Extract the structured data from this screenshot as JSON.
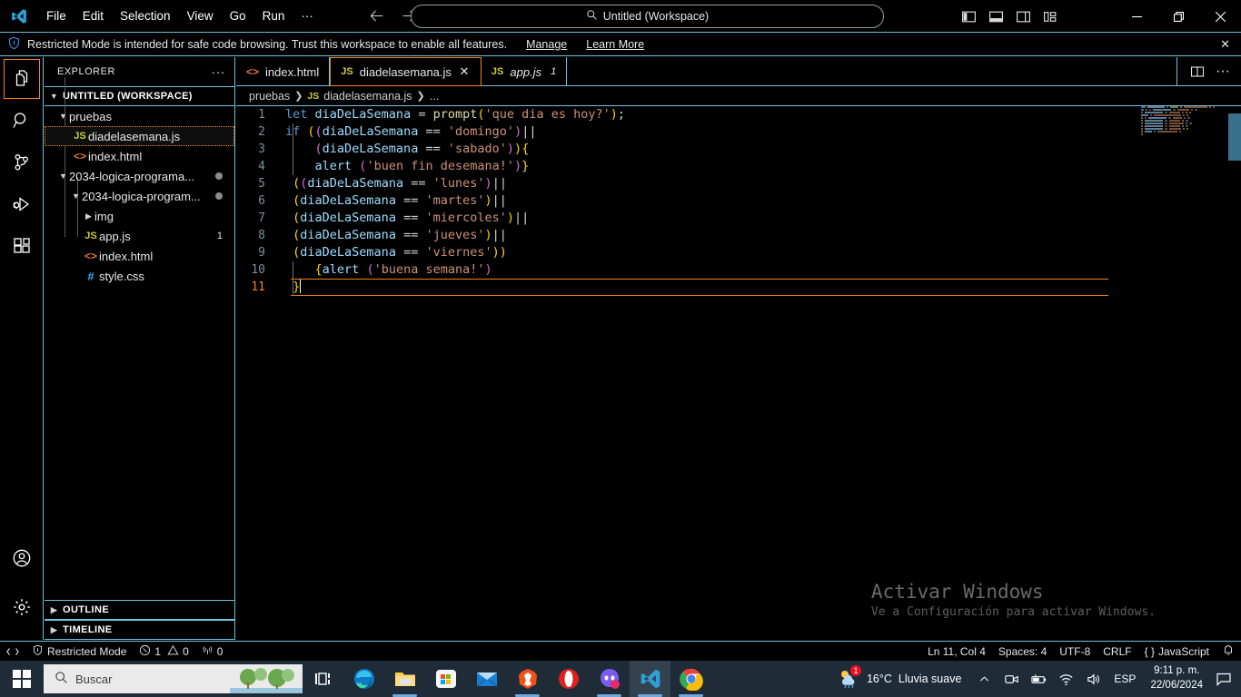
{
  "titlebar": {
    "logo_icon": "vscode-logo",
    "menus": [
      "File",
      "Edit",
      "Selection",
      "View",
      "Go",
      "Run",
      "···"
    ],
    "back_icon": "arrow-left-icon",
    "forward_icon": "arrow-right-icon",
    "command_center": {
      "icon": "search-icon",
      "text": "Untitled (Workspace)"
    },
    "layout_buttons": [
      {
        "name": "toggle-primary-sidebar",
        "icon": "layout-sidebar-left-icon"
      },
      {
        "name": "toggle-panel",
        "icon": "layout-panel-icon"
      },
      {
        "name": "toggle-secondary-sidebar",
        "icon": "layout-sidebar-right-icon"
      },
      {
        "name": "customize-layout",
        "icon": "layout-customize-icon"
      }
    ],
    "window_controls": [
      {
        "name": "minimize",
        "glyph": "─"
      },
      {
        "name": "maximize",
        "glyph": "❐"
      },
      {
        "name": "close",
        "glyph": "✕"
      }
    ]
  },
  "banner": {
    "icon": "shield-icon",
    "message": "Restricted Mode is intended for safe code browsing. Trust this workspace to enable all features.",
    "manage_label": "Manage",
    "learn_more_label": "Learn More",
    "close_glyph": "✕"
  },
  "activitybar": {
    "items": [
      {
        "name": "explorer",
        "icon": "files-icon",
        "active": true
      },
      {
        "name": "search",
        "icon": "search-icon",
        "active": false
      },
      {
        "name": "source-control",
        "icon": "source-control-icon",
        "active": false
      },
      {
        "name": "run-and-debug",
        "icon": "run-debug-icon",
        "active": false
      },
      {
        "name": "extensions",
        "icon": "extensions-icon",
        "active": false
      }
    ],
    "bottom": [
      {
        "name": "accounts",
        "icon": "account-icon"
      },
      {
        "name": "manage-settings",
        "icon": "gear-icon"
      }
    ]
  },
  "sidebar": {
    "title": "EXPLORER",
    "more_actions_glyph": "···",
    "workspace_label": "UNTITLED (WORKSPACE)",
    "tree": [
      {
        "label": "pruebas",
        "type": "folder",
        "depth": 1,
        "expanded": true
      },
      {
        "label": "diadelasemana.js",
        "type": "js",
        "depth": 2,
        "selected": true
      },
      {
        "label": "index.html",
        "type": "html",
        "depth": 2
      },
      {
        "label": "2034-logica-programa...",
        "type": "folder",
        "depth": 1,
        "expanded": true,
        "dot": true
      },
      {
        "label": "2034-logica-program...",
        "type": "folder",
        "depth": 2,
        "expanded": true,
        "dot": true
      },
      {
        "label": "img",
        "type": "folder",
        "depth": 3,
        "expanded": false
      },
      {
        "label": "app.js",
        "type": "js",
        "depth": 3,
        "badge": "1"
      },
      {
        "label": "index.html",
        "type": "html",
        "depth": 3
      },
      {
        "label": "style.css",
        "type": "css",
        "depth": 3
      }
    ],
    "sections": [
      {
        "label": "OUTLINE"
      },
      {
        "label": "TIMELINE"
      }
    ]
  },
  "editor": {
    "tabs": [
      {
        "label": "index.html",
        "icon": "html-file-icon",
        "active": false,
        "preview": false
      },
      {
        "label": "diadelasemana.js",
        "icon": "js-file-icon",
        "active": true,
        "preview": false,
        "close_glyph": "✕"
      },
      {
        "label": "app.js",
        "icon": "js-file-icon",
        "active": false,
        "preview": true,
        "badge": "1"
      }
    ],
    "actions": [
      {
        "name": "split-editor-right",
        "icon": "split-editor-icon"
      },
      {
        "name": "more-editor-actions",
        "icon": "ellipsis-icon"
      }
    ],
    "breadcrumb": [
      "pruebas",
      "diadelasemana.js",
      "..."
    ],
    "code_lines": [
      {
        "n": "1",
        "tokens": [
          {
            "t": "let",
            "c": "k"
          },
          {
            "t": " ",
            "c": "op"
          },
          {
            "t": "diaDeLaSemana",
            "c": "var"
          },
          {
            "t": " ",
            "c": "op"
          },
          {
            "t": "=",
            "c": "op"
          },
          {
            "t": " ",
            "c": "op"
          },
          {
            "t": "prompt",
            "c": "fn"
          },
          {
            "t": "(",
            "c": "b1"
          },
          {
            "t": "'que dia es hoy?'",
            "c": "str"
          },
          {
            "t": ")",
            "c": "b1"
          },
          {
            "t": ";",
            "c": "op"
          }
        ]
      },
      {
        "n": "2",
        "tokens": [
          {
            "t": "if",
            "c": "k"
          },
          {
            "t": " ",
            "c": "op"
          },
          {
            "t": "(",
            "c": "b1"
          },
          {
            "t": "(",
            "c": "b2"
          },
          {
            "t": "diaDeLaSemana",
            "c": "var"
          },
          {
            "t": " ",
            "c": "op"
          },
          {
            "t": "==",
            "c": "op"
          },
          {
            "t": " ",
            "c": "op"
          },
          {
            "t": "'domingo'",
            "c": "str"
          },
          {
            "t": ")",
            "c": "b2"
          },
          {
            "t": "||",
            "c": "op"
          }
        ]
      },
      {
        "n": "3",
        "indent": 1,
        "tokens": [
          {
            "t": "    ",
            "c": "op"
          },
          {
            "t": "(",
            "c": "b2"
          },
          {
            "t": "diaDeLaSemana",
            "c": "var"
          },
          {
            "t": " ",
            "c": "op"
          },
          {
            "t": "==",
            "c": "op"
          },
          {
            "t": " ",
            "c": "op"
          },
          {
            "t": "'sabado'",
            "c": "str"
          },
          {
            "t": ")",
            "c": "b2"
          },
          {
            "t": ")",
            "c": "b1"
          },
          {
            "t": "{",
            "c": "b1"
          }
        ]
      },
      {
        "n": "4",
        "indent": 1,
        "tokens": [
          {
            "t": "    ",
            "c": "op"
          },
          {
            "t": "alert",
            "c": "var"
          },
          {
            "t": " ",
            "c": "op"
          },
          {
            "t": "(",
            "c": "b2"
          },
          {
            "t": "'buen fin desemana!'",
            "c": "str"
          },
          {
            "t": ")",
            "c": "b2"
          },
          {
            "t": "}",
            "c": "b1"
          }
        ]
      },
      {
        "n": "5",
        "tokens": [
          {
            "t": " ",
            "c": "op"
          },
          {
            "t": "(",
            "c": "b1"
          },
          {
            "t": "(",
            "c": "b2"
          },
          {
            "t": "diaDeLaSemana",
            "c": "var"
          },
          {
            "t": " ",
            "c": "op"
          },
          {
            "t": "==",
            "c": "op"
          },
          {
            "t": " ",
            "c": "op"
          },
          {
            "t": "'lunes'",
            "c": "str"
          },
          {
            "t": ")",
            "c": "b2"
          },
          {
            "t": "||",
            "c": "op"
          }
        ]
      },
      {
        "n": "6",
        "tokens": [
          {
            "t": " ",
            "c": "op"
          },
          {
            "t": "(",
            "c": "b1"
          },
          {
            "t": "diaDeLaSemana",
            "c": "var"
          },
          {
            "t": " ",
            "c": "op"
          },
          {
            "t": "==",
            "c": "op"
          },
          {
            "t": " ",
            "c": "op"
          },
          {
            "t": "'martes'",
            "c": "str"
          },
          {
            "t": ")",
            "c": "b1"
          },
          {
            "t": "||",
            "c": "op"
          }
        ]
      },
      {
        "n": "7",
        "tokens": [
          {
            "t": " ",
            "c": "op"
          },
          {
            "t": "(",
            "c": "b1"
          },
          {
            "t": "diaDeLaSemana",
            "c": "var"
          },
          {
            "t": " ",
            "c": "op"
          },
          {
            "t": "==",
            "c": "op"
          },
          {
            "t": " ",
            "c": "op"
          },
          {
            "t": "'miercoles'",
            "c": "str"
          },
          {
            "t": ")",
            "c": "b1"
          },
          {
            "t": "||",
            "c": "op"
          }
        ]
      },
      {
        "n": "8",
        "tokens": [
          {
            "t": " ",
            "c": "op"
          },
          {
            "t": "(",
            "c": "b1"
          },
          {
            "t": "diaDeLaSemana",
            "c": "var"
          },
          {
            "t": " ",
            "c": "op"
          },
          {
            "t": "==",
            "c": "op"
          },
          {
            "t": " ",
            "c": "op"
          },
          {
            "t": "'jueves'",
            "c": "str"
          },
          {
            "t": ")",
            "c": "b1"
          },
          {
            "t": "||",
            "c": "op"
          }
        ]
      },
      {
        "n": "9",
        "tokens": [
          {
            "t": " ",
            "c": "op"
          },
          {
            "t": "(",
            "c": "b1"
          },
          {
            "t": "diaDeLaSemana",
            "c": "var"
          },
          {
            "t": " ",
            "c": "op"
          },
          {
            "t": "==",
            "c": "op"
          },
          {
            "t": " ",
            "c": "op"
          },
          {
            "t": "'viernes'",
            "c": "str"
          },
          {
            "t": ")",
            "c": "b1"
          },
          {
            "t": ")",
            "c": "b1"
          }
        ]
      },
      {
        "n": "10",
        "indent": 1,
        "tokens": [
          {
            "t": "    ",
            "c": "op"
          },
          {
            "t": "{",
            "c": "b1"
          },
          {
            "t": "alert",
            "c": "var"
          },
          {
            "t": " ",
            "c": "op"
          },
          {
            "t": "(",
            "c": "b2"
          },
          {
            "t": "'buena semana!'",
            "c": "str"
          },
          {
            "t": ")",
            "c": "b2"
          }
        ]
      },
      {
        "n": "11",
        "current": true,
        "indent": 1,
        "tokens": [
          {
            "t": " ",
            "c": "op"
          },
          {
            "t": "}",
            "c": "b1"
          }
        ]
      }
    ]
  },
  "watermark": {
    "title": "Activar Windows",
    "subtitle": "Ve a Configuración para activar Windows."
  },
  "statusbar": {
    "left": [
      {
        "name": "remote-indicator",
        "icon": "remote-icon",
        "label": ""
      },
      {
        "name": "restricted-mode",
        "icon": "shield-icon",
        "label": "Restricted Mode"
      },
      {
        "name": "problems",
        "icon": "error-icon",
        "label": "1",
        "icon2": "warning-icon",
        "label2": "0"
      },
      {
        "name": "ports",
        "icon": "radio-tower-icon",
        "label": "0"
      }
    ],
    "right": [
      {
        "name": "editor-position",
        "label": "Ln 11, Col 4"
      },
      {
        "name": "editor-indentation",
        "label": "Spaces: 4"
      },
      {
        "name": "editor-encoding",
        "label": "UTF-8"
      },
      {
        "name": "editor-eol",
        "label": "CRLF"
      },
      {
        "name": "editor-language",
        "label": "JavaScript",
        "icon": "braces-icon"
      },
      {
        "name": "notifications",
        "icon": "bell-icon",
        "label": ""
      }
    ]
  },
  "taskbar": {
    "start_icon": "windows-start-icon",
    "search": {
      "icon": "search-icon",
      "placeholder": "Buscar"
    },
    "task_view_icon": "task-view-icon",
    "apps": [
      {
        "name": "microsoft-edge",
        "icon": "edge-icon",
        "running": false
      },
      {
        "name": "file-explorer",
        "icon": "folder-icon",
        "running": true
      },
      {
        "name": "microsoft-store",
        "icon": "store-icon",
        "running": false
      },
      {
        "name": "mail",
        "icon": "mail-icon",
        "running": false
      },
      {
        "name": "brave-browser",
        "icon": "brave-icon",
        "running": true
      },
      {
        "name": "opera-browser",
        "icon": "opera-icon",
        "running": false
      },
      {
        "name": "discord",
        "icon": "discord-icon",
        "running": true
      },
      {
        "name": "visual-studio-code",
        "icon": "vscode-icon",
        "running": true,
        "active": true
      },
      {
        "name": "google-chrome",
        "icon": "chrome-icon",
        "running": true
      }
    ],
    "tray": {
      "weather": {
        "icon": "weather-rain-icon",
        "badge": "1",
        "temperature": "16°C",
        "condition": "Lluvia suave"
      },
      "chevron_glyph": "∧",
      "icons": [
        {
          "name": "meet-now-icon"
        },
        {
          "name": "battery-icon"
        },
        {
          "name": "wifi-icon"
        },
        {
          "name": "volume-icon"
        }
      ],
      "language": "ESP",
      "time": "9:11 p. m.",
      "date": "22/06/2024",
      "action_center_icon": "action-center-icon"
    }
  }
}
